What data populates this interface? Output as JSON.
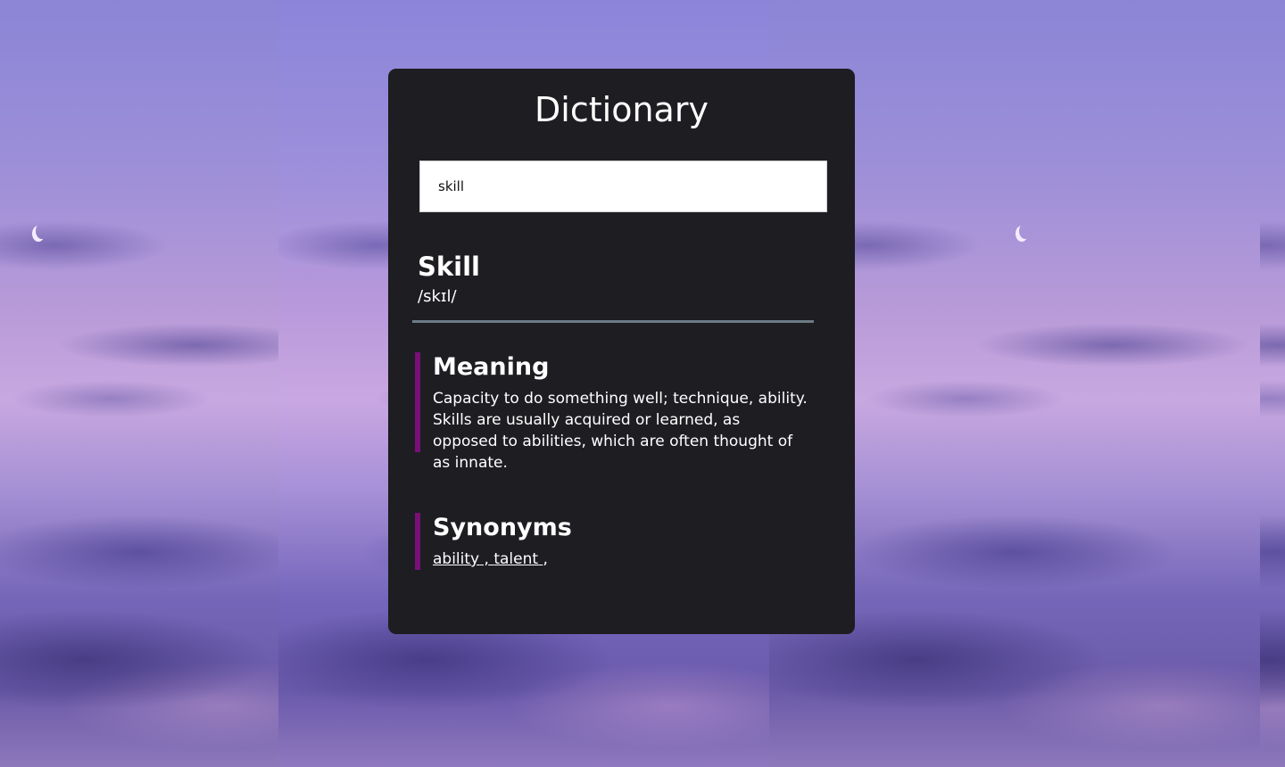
{
  "app": {
    "title": "Dictionary"
  },
  "search": {
    "value": "skill"
  },
  "result": {
    "word": "Skill",
    "phonetic": "/skɪl/",
    "meaning_heading": "Meaning",
    "meaning_text": "Capacity to do something well; technique, ability. Skills are usually acquired or learned, as opposed to abilities, which are often thought of as innate.",
    "synonyms_heading": "Synonyms",
    "synonyms": [
      "ability",
      "talent"
    ]
  },
  "colors": {
    "card_background": "#1e1d22",
    "accent_bar": "#7a0f7a",
    "divider": "#6b7b86",
    "text": "#ffffff"
  },
  "icons": {
    "moon": "crescent-moon-icon"
  }
}
